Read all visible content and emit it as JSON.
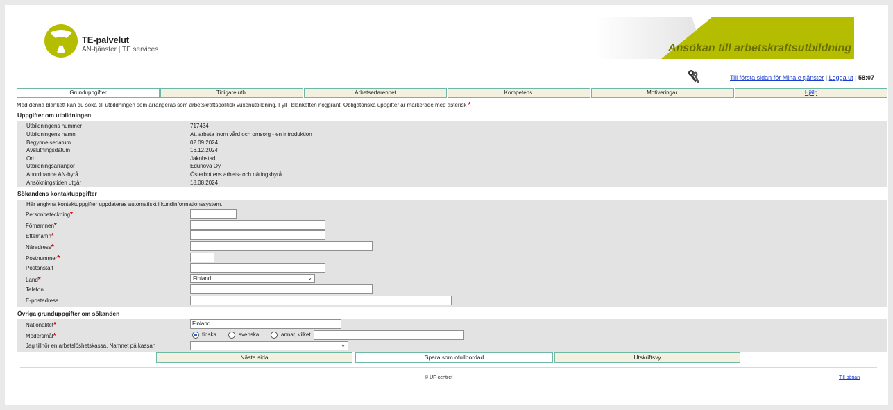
{
  "header": {
    "logo_title": "TE-palvelut",
    "logo_subtitle": "AN-tjänster | TE services",
    "banner_title": "Ansökan till arbetskraftsutbildning",
    "link_first_page": "Till första sidan för Mina e-tjänster",
    "separator": "|",
    "link_logout": "Logga ut",
    "timer": "58:07",
    "brand_color": "#b5bd00"
  },
  "tabs": [
    {
      "label": "Grunduppgifter"
    },
    {
      "label": "Tidigare utb."
    },
    {
      "label": "Arbetserfarenhet"
    },
    {
      "label": "Kompetens."
    },
    {
      "label": "Motiveringar."
    },
    {
      "label": "Hjälp"
    }
  ],
  "intro_text": "Med denna blankett kan du söka till utbildningen som arrangeras som arbetskraftspolitisk vuxenutbildning. Fyll i blanketten noggrant. Obligatoriska uppgifter är markerade med asterisk",
  "required_marker": "*",
  "education": {
    "title": "Uppgifter om utbildningen",
    "rows": [
      {
        "label": "Utbildningens nummer",
        "value": "717434"
      },
      {
        "label": "Utbildningens namn",
        "value": "Att arbeta inom vård och omsorg - en introduktion"
      },
      {
        "label": "Begynnelsedatum",
        "value": "02.09.2024"
      },
      {
        "label": "Avslutningsdatum",
        "value": "16.12.2024"
      },
      {
        "label": "Ort",
        "value": "Jakobstad"
      },
      {
        "label": "Utbildningsarrangör",
        "value": "Edunova Oy"
      },
      {
        "label": "Anordnande AN-byrå",
        "value": "Österbottens arbets- och näringsbyrå"
      },
      {
        "label": "Ansökningstiden utgår",
        "value": "18.08.2024"
      }
    ]
  },
  "contact": {
    "title": "Sökandens kontaktuppgifter",
    "note": "Här angivna kontaktuppgifter uppdateras automatiskt i kundinformationssystem.",
    "fields": [
      {
        "label": "Personbeteckning",
        "value": ""
      },
      {
        "label": "Förnamnen",
        "value": ""
      },
      {
        "label": "Efternamn",
        "value": ""
      },
      {
        "label": "Näradress",
        "value": ""
      },
      {
        "label": "Postnummer",
        "value": ""
      },
      {
        "label": "Postanstalt",
        "value": ""
      },
      {
        "label": "Land",
        "value": "Finland"
      },
      {
        "label": "Telefon",
        "value": ""
      },
      {
        "label": "E-postadress",
        "value": ""
      }
    ]
  },
  "other": {
    "title": "Övriga grunduppgifter om sökanden",
    "nationality_label": "Nationalitet",
    "nationality_value": "Finland",
    "mother_tongue_label": "Modersmål",
    "mother_tongue_options": [
      "finska",
      "svenska",
      "annat, vilket"
    ],
    "mother_tongue_selected": "finska",
    "mother_tongue_other_value": "",
    "fund_label": "Jag tillhör en arbetslöshetskassa. Namnet på kassan",
    "fund_value": ""
  },
  "buttons": {
    "next": "Nästa sida",
    "save_incomplete": "Spara som ofullbordad",
    "print": "Utskriftsvy"
  },
  "footer": {
    "copyright": "© UF-centret",
    "to_top": "Till början"
  }
}
